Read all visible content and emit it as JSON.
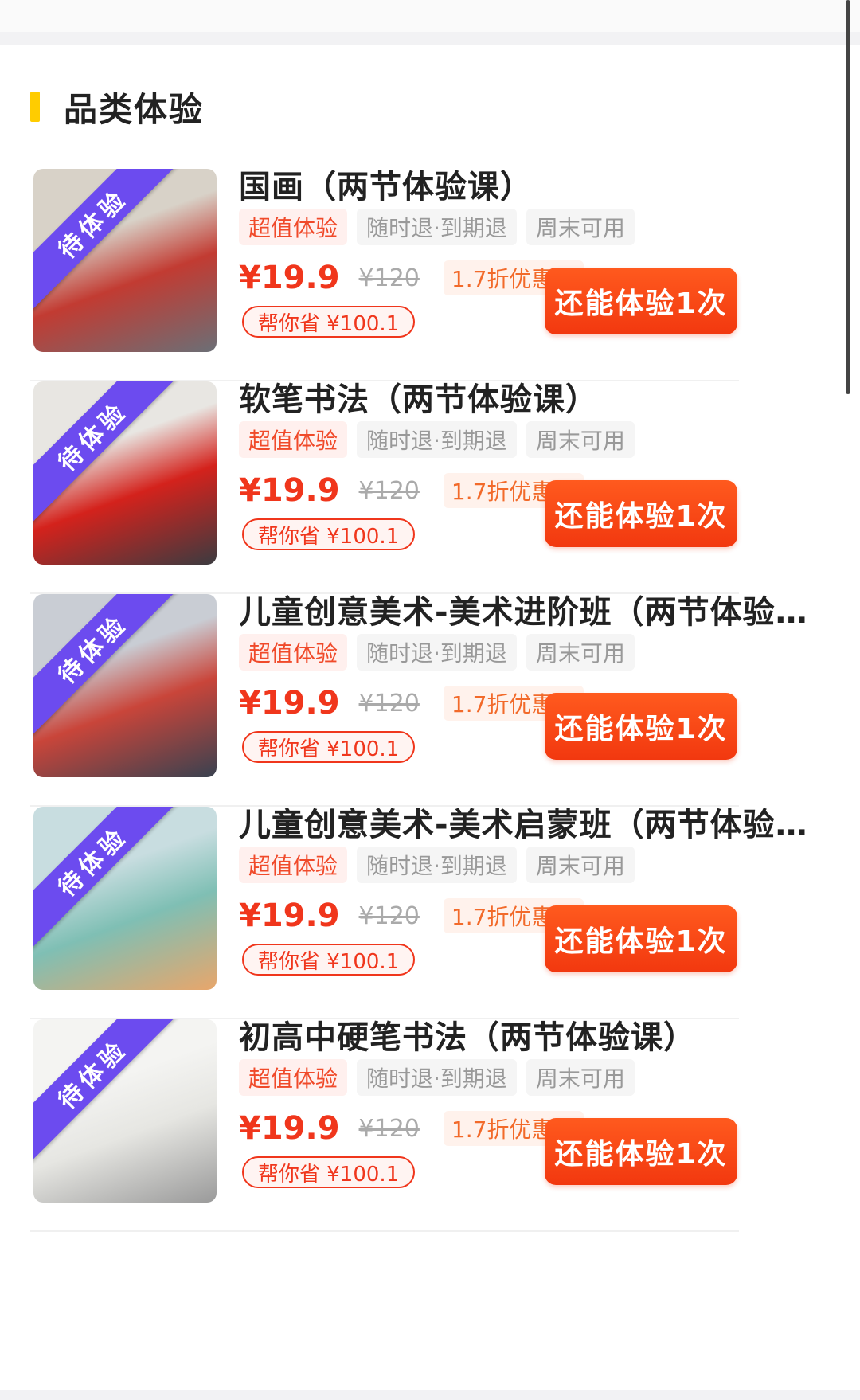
{
  "section": {
    "title": "品类体验"
  },
  "courses": [
    {
      "title": "国画（两节体验课）",
      "ribbon": "待体验",
      "tags": [
        "超值体验",
        "随时退·到期退",
        "周末可用"
      ],
      "price": "¥19.9",
      "original_price": "¥120",
      "discount": "1.7折优惠中",
      "savings": "帮你省 ¥100.1",
      "cta": "还能体验1次",
      "photo_colors": [
        "#d8d2c8",
        "#c23b32",
        "#6b6f76"
      ]
    },
    {
      "title": "软笔书法（两节体验课）",
      "ribbon": "待体验",
      "tags": [
        "超值体验",
        "随时退·到期退",
        "周末可用"
      ],
      "price": "¥19.9",
      "original_price": "¥120",
      "discount": "1.7折优惠中",
      "savings": "帮你省 ¥100.1",
      "cta": "还能体验1次",
      "photo_colors": [
        "#e8e6e2",
        "#d4221c",
        "#3b3b40"
      ]
    },
    {
      "title": "儿童创意美术-美术进阶班（两节体验课）",
      "ribbon": "待体验",
      "tags": [
        "超值体验",
        "随时退·到期退",
        "周末可用"
      ],
      "price": "¥19.9",
      "original_price": "¥120",
      "discount": "1.7折优惠中",
      "savings": "帮你省 ¥100.1",
      "cta": "还能体验1次",
      "photo_colors": [
        "#c9cdd4",
        "#c9453a",
        "#394250"
      ]
    },
    {
      "title": "儿童创意美术-美术启蒙班（两节体验课）",
      "ribbon": "待体验",
      "tags": [
        "超值体验",
        "随时退·到期退",
        "周末可用"
      ],
      "price": "¥19.9",
      "original_price": "¥120",
      "discount": "1.7折优惠中",
      "savings": "帮你省 ¥100.1",
      "cta": "还能体验1次",
      "photo_colors": [
        "#c8dde0",
        "#7fbfb4",
        "#e8a66b"
      ]
    },
    {
      "title": "初高中硬笔书法（两节体验课）",
      "ribbon": "待体验",
      "tags": [
        "超值体验",
        "随时退·到期退",
        "周末可用"
      ],
      "price": "¥19.9",
      "original_price": "¥120",
      "discount": "1.7折优惠中",
      "savings": "帮你省 ¥100.1",
      "cta": "还能体验1次",
      "photo_colors": [
        "#f4f4f2",
        "#e6e6e2",
        "#9a9a9a"
      ]
    }
  ]
}
